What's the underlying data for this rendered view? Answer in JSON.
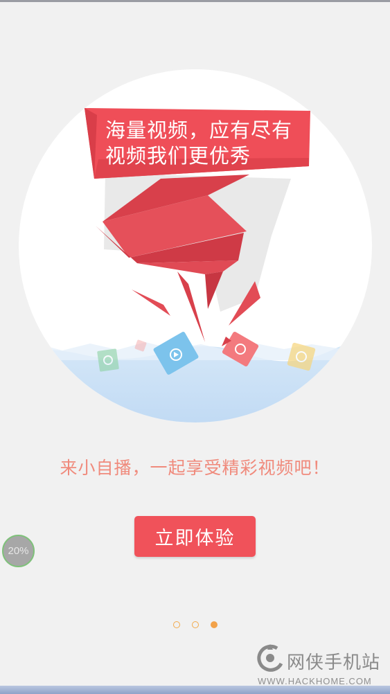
{
  "banner": {
    "line1": "海量视频，应有尽有",
    "line2": "视频我们更优秀"
  },
  "slogan": "来小自播，一起享受精彩视频吧！",
  "cta_label": "立即体验",
  "progress_text": "20%",
  "pager": {
    "count": 3,
    "active_index": 2
  },
  "watermark": {
    "name": "网侠手机站",
    "url": "WWW.HACKHOME.COM"
  },
  "colors": {
    "accent": "#f0525a",
    "slogan": "#f08a7c",
    "dot": "#f2a24a",
    "water": "#c7def5"
  },
  "icons": [
    "ribbon-illustration",
    "play-ticket-icon",
    "progress-ring"
  ]
}
